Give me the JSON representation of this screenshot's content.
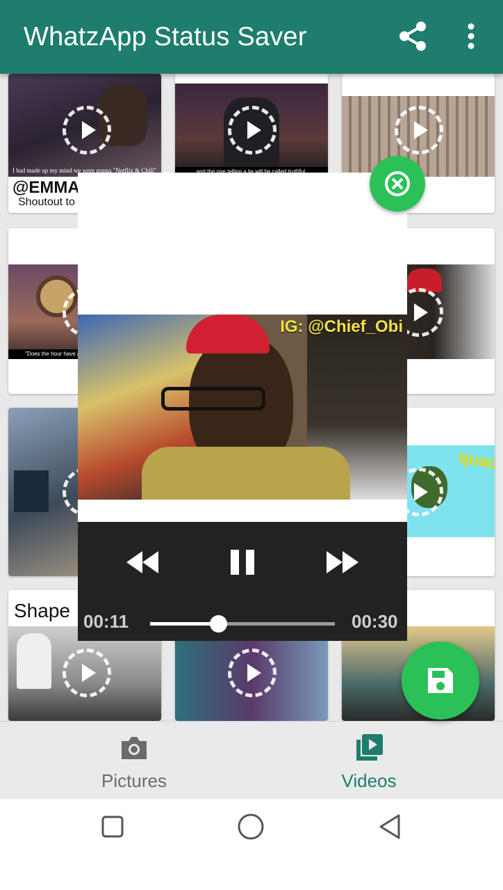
{
  "app": {
    "title": "WhatzApp Status Saver",
    "accent_color": "#1e7d6c",
    "fab_color": "#2bc158"
  },
  "toolbar": {
    "share_icon": "share-icon",
    "more_icon": "more-vert-icon"
  },
  "grid": {
    "cards": [
      {
        "caption": ""
      },
      {
        "caption": ""
      },
      {
        "caption": ""
      },
      {
        "caption": ""
      },
      {
        "caption": ""
      },
      {
        "caption": ""
      },
      {
        "caption": "Shape"
      }
    ],
    "thumb_texts": {
      "card1_handle": "@EMMA",
      "card1_sub": "Shoutout to @",
      "card1_quote": "I had made up my mind we were gonna \"Netflix & Chill\"",
      "card2_quote": "and the one telling a lie will be called truthful.",
      "card4_quote": "\"Does the hour have a l",
      "card6_duck": "quac"
    }
  },
  "player": {
    "watermark": "IG: @Chief_Obi",
    "current_time": "00:11",
    "total_time": "00:30",
    "progress": 0.37,
    "rewind_icon": "rewind-icon",
    "pause_icon": "pause-icon",
    "forward_icon": "fast-forward-icon",
    "close_icon": "close-icon"
  },
  "save_fab": {
    "icon": "save-icon"
  },
  "bottom_nav": {
    "tabs": [
      {
        "label": "Pictures",
        "icon": "camera-icon",
        "active": false,
        "color": "#6b6b6b"
      },
      {
        "label": "Videos",
        "icon": "video-library-icon",
        "active": true,
        "color": "#1e7d6c"
      }
    ]
  },
  "system_nav": {
    "recent_icon": "square-icon",
    "home_icon": "circle-icon",
    "back_icon": "triangle-back-icon"
  }
}
